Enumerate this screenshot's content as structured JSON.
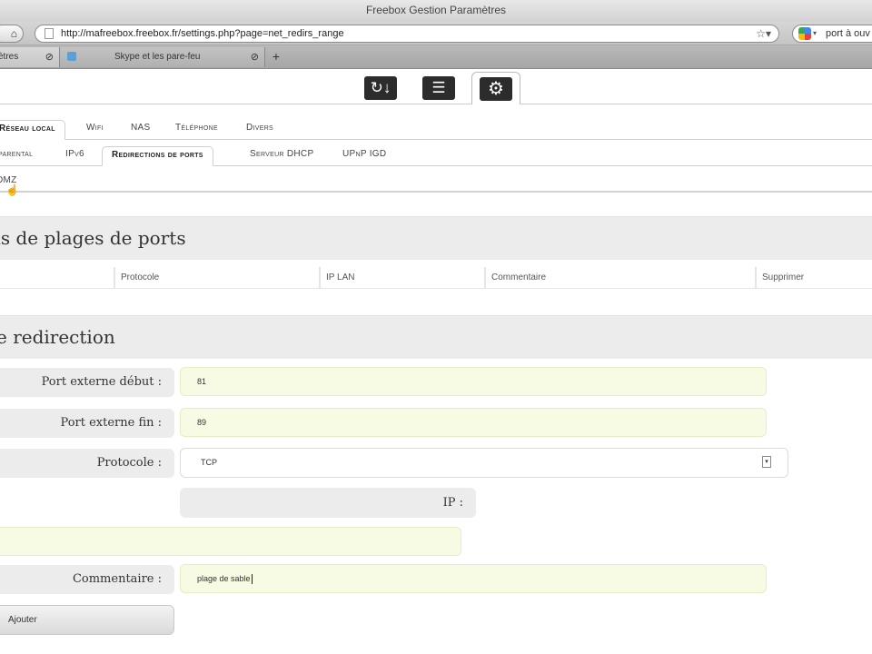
{
  "browser": {
    "window_title": "Freebox Gestion Paramètres",
    "url": "http://mafreebox.freebox.fr/settings.php?page=net_redirs_range",
    "search_text": "port à ouv",
    "tabs": [
      {
        "label": "ètres"
      },
      {
        "label": "Skype et les pare-feu"
      }
    ],
    "new_tab_label": "+"
  },
  "app_icons": [
    "download-icon",
    "list-icon",
    "settings-icon"
  ],
  "nav": {
    "level1": [
      "Réseau local",
      "Wifi",
      "NAS",
      "Téléphone",
      "Divers"
    ],
    "level2": [
      "parental",
      "IPv6",
      "Redirections de ports",
      "Serveur DHCP",
      "UPnP IGD"
    ],
    "level3": [
      "DMZ"
    ]
  },
  "section_list": {
    "title": "ns de plages de ports",
    "columns": [
      "Protocole",
      "IP LAN",
      "Commentaire",
      "Supprimer"
    ]
  },
  "section_form": {
    "title": "e redirection",
    "fields": {
      "port_start_label": "Port externe début :",
      "port_start_value": "81",
      "port_end_label": "Port externe fin :",
      "port_end_value": "89",
      "protocol_label": "Protocole :",
      "protocol_value": "TCP",
      "ip_label": "IP :",
      "ip_value": "",
      "comment_label": "Commentaire :",
      "comment_value": "plage de sable"
    },
    "submit_label": "Ajouter"
  },
  "colors": {
    "input_bg": "#f7fbe4",
    "section_bg": "#ececec"
  }
}
